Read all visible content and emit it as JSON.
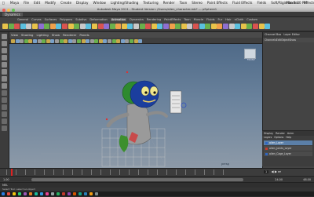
{
  "macbar": {
    "menus": [
      "Maya",
      "File",
      "Edit",
      "Modify",
      "Create",
      "Display",
      "Window",
      "Lighting/Shading",
      "Texturing",
      "Render",
      "Toon",
      "Stereo",
      "Paint Effects",
      "Fluid Effects",
      "Fields",
      "Soft/Rigid Bodies",
      "Effects",
      "Solvers",
      "Muscle",
      "Help"
    ],
    "clock": "Mon 4:20 PM"
  },
  "window": {
    "title": "Autodesk Maya 2011 - Student Version: /Users/alien_character.mb* --- pSphere1"
  },
  "statusline": {
    "mode": "Dynamics"
  },
  "shelf": {
    "tabs": [
      "General",
      "Curves",
      "Surfaces",
      "Polygons",
      "Subdivs",
      "Deformation",
      "Animation",
      "Dynamics",
      "Rendering",
      "PaintEffects",
      "Toon",
      "Muscle",
      "Fluids",
      "Fur",
      "Hair",
      "nCloth",
      "Custom"
    ],
    "active_tab": "Animation",
    "icon_colors": [
      "#e8c34a",
      "#6ab04c",
      "#d9534f",
      "#5bc0de",
      "#c9c9c9",
      "#e8c34a",
      "#8e6fd1",
      "#6ab04c",
      "#f0a04b",
      "#5bc0de",
      "#d9534f",
      "#e8c34a",
      "#6ab04c",
      "#c9c9c9",
      "#5bc0de",
      "#e8c34a",
      "#d9534f",
      "#8e6fd1",
      "#6ab04c",
      "#f0a04b",
      "#e8c34a",
      "#5bc0de",
      "#c9c9c9",
      "#6ab04c",
      "#d9534f",
      "#e8c34a",
      "#5bc0de",
      "#8e6fd1",
      "#f0a04b",
      "#6ab04c",
      "#e8c34a",
      "#c9c9c9",
      "#d9534f",
      "#5bc0de",
      "#6ab04c",
      "#e8c34a",
      "#f0a04b",
      "#8e6fd1",
      "#c9c9c9",
      "#5bc0de",
      "#e8c34a",
      "#6ab04c",
      "#d9534f",
      "#e8c34a",
      "#5bc0de"
    ]
  },
  "tools": {
    "left_icons": [
      "select-tool-icon",
      "lasso-tool-icon",
      "paint-select-icon",
      "move-tool-icon",
      "rotate-tool-icon",
      "scale-tool-icon",
      "manipulator-icon",
      "last-tool-icon",
      "single-layout-icon",
      "four-layout-icon",
      "outliner-layout-icon",
      "graph-layout-icon",
      "hypershade-layout-icon",
      "dope-sheet-layout-icon"
    ]
  },
  "panel": {
    "menus": [
      "View",
      "Shading",
      "Lighting",
      "Show",
      "Renderer",
      "Panels"
    ],
    "camera_label": "persp"
  },
  "viewcube": {
    "label": "FRONT"
  },
  "channelbox": {
    "tabs": [
      "Channel Box",
      "Layer Editor"
    ],
    "submenu": [
      "Channels",
      "Edit",
      "Object",
      "Show"
    ]
  },
  "layers": {
    "tabs": [
      "Display",
      "Render",
      "Anim"
    ],
    "menu": [
      "Layers",
      "Options",
      "Help"
    ],
    "items": [
      {
        "label": "alien_Layer",
        "color": "#2e66c4",
        "selected": true
      },
      {
        "label": "alien_Joints_Layer",
        "color": "#c43b2e",
        "selected": false
      },
      {
        "label": "alien_Cage_Layer",
        "color": "#2e66c4",
        "selected": false
      }
    ]
  },
  "timeline": {
    "current_frame": 1,
    "start": "1.00",
    "end": "24.00",
    "range_end": "48.00"
  },
  "cmdline": {
    "label": "MEL"
  },
  "helpline": {
    "text": "Select Tool: select an object"
  },
  "dock": {
    "colors": [
      "#2a7de1",
      "#e74c3c",
      "#f1c40f",
      "#2ecc71",
      "#9b59b6",
      "#e67e22",
      "#1abc9c",
      "#3498db",
      "#e84393",
      "#95a5a6",
      "#27ae60",
      "#c0392b",
      "#8e44ad",
      "#d35400",
      "#16a085",
      "#2980b9",
      "#f39c12",
      "#7f8c8d"
    ]
  }
}
